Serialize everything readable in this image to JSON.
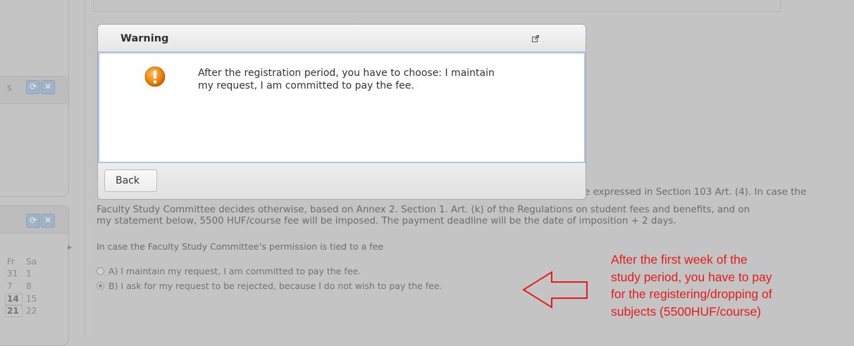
{
  "sidebar": {
    "panel2_letter": "s",
    "calendar": {
      "next_arrow": "▸",
      "header": [
        "Fr",
        "Sa"
      ],
      "rows": [
        [
          "31",
          "1"
        ],
        [
          "7",
          "8"
        ],
        [
          "14",
          "15"
        ],
        [
          "21",
          "22"
        ]
      ]
    }
  },
  "page": {
    "paragraph_tail": "e expressed in Section 103 Art. (4). In case the",
    "paragraph_line2": "Faculty Study Committee decides otherwise, based on Annex 2. Section 1. Art. (k) of the Regulations on student fees and benefits, and on",
    "paragraph_line3": "my statement below, 5500 HUF/course fee will be imposed. The payment deadline will be the date of imposition + 2 days.",
    "fee_intro": "In case the Faculty Study Committee’s permission is tied to a fee",
    "option_a": "A) I maintain my request, I am committed to pay the fee.",
    "option_b": "B) I ask for my request to be rejected, because I do not wish to pay the fee.",
    "option_selected": "B"
  },
  "annotation": {
    "lines": [
      "After the first week of the",
      "study period, you have to pay",
      "for the registering/dropping of",
      "subjects (5500HUF/course)"
    ],
    "color": "#e41b1b"
  },
  "dialog": {
    "title": "Warning",
    "icon": "warning-icon",
    "message_line1": "After the registration period, you have to choose: I maintain",
    "message_line2": "my request, I am committed to pay the fee.",
    "back_label": "Back"
  }
}
